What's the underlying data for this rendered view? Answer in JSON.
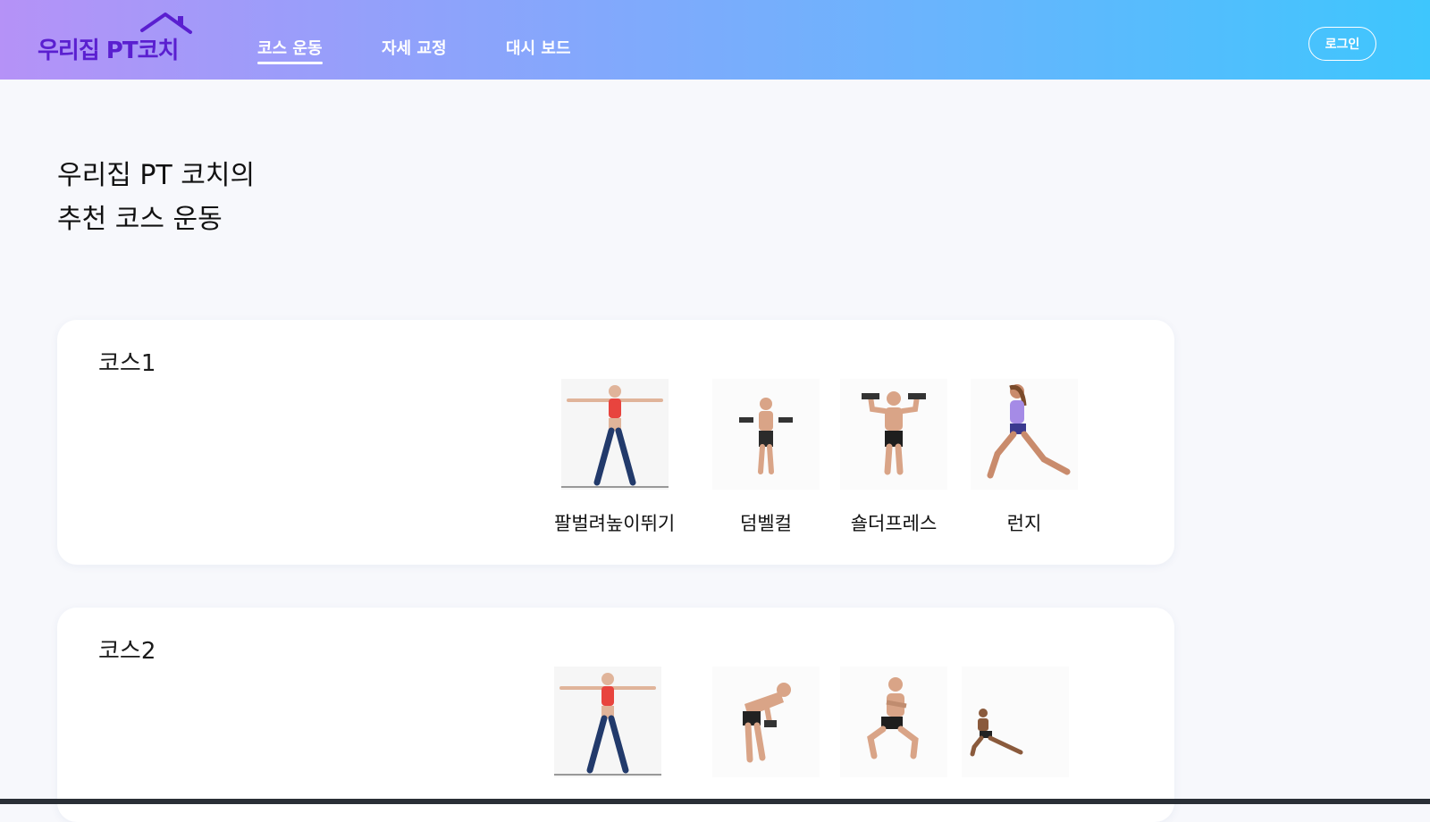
{
  "app": {
    "logo_text": "우리집 PT코치"
  },
  "nav": {
    "items": [
      {
        "label": "코스 운동",
        "active": true
      },
      {
        "label": "자세 교정",
        "active": false
      },
      {
        "label": "대시 보드",
        "active": false
      }
    ],
    "login_label": "로그인"
  },
  "main": {
    "heading_line1": "우리집 PT 코치의",
    "heading_line2": "추천 코스 운동",
    "courses": [
      {
        "title": "코스1",
        "exercises": [
          {
            "name": "팔벌려높이뛰기"
          },
          {
            "name": "덤벨컬"
          },
          {
            "name": "숄더프레스"
          },
          {
            "name": "런지"
          }
        ]
      },
      {
        "title": "코스2",
        "exercises": [
          {
            "name": ""
          },
          {
            "name": ""
          },
          {
            "name": ""
          },
          {
            "name": ""
          }
        ]
      }
    ]
  },
  "colors": {
    "header_gradient_start": "#b592f7",
    "header_gradient_end": "#3ec6fd",
    "logo": "#5a1fd0",
    "background": "#f7f8fc"
  }
}
